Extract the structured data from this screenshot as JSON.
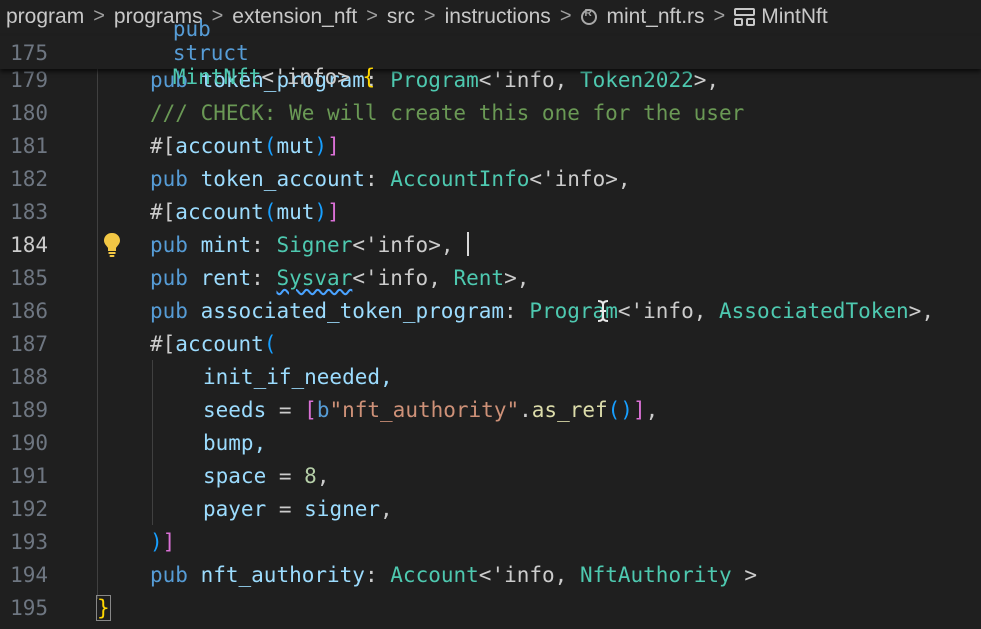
{
  "breadcrumb": {
    "items": [
      "program",
      "programs",
      "extension_nft",
      "src",
      "instructions",
      "mint_nft.rs",
      "MintNft"
    ],
    "separator": ">"
  },
  "sticky": {
    "line": "175",
    "pub": "pub",
    "struct": "struct",
    "name": "MintNft",
    "lt": "<'info>",
    "brace": "{"
  },
  "lines": [
    {
      "n": "179",
      "pub": "pub",
      "field": "token_program",
      "colon": ":",
      "type": "Program",
      "lt": "<'info, ",
      "t2": "Token2022",
      "end": ">,"
    },
    {
      "n": "180",
      "comment": "/// CHECK: We will create this one for the user"
    },
    {
      "n": "181",
      "hash": "#[",
      "attr": "account",
      "p1": "(",
      "arg": "mut",
      "p2": ")",
      "close": "]"
    },
    {
      "n": "182",
      "pub": "pub",
      "field": "token_account",
      "colon": ":",
      "type": "AccountInfo",
      "lt": "<'info>,"
    },
    {
      "n": "183",
      "hash": "#[",
      "attr": "account",
      "p1": "(",
      "arg": "mut",
      "p2": ")",
      "close": "]"
    },
    {
      "n": "184",
      "pub": "pub",
      "field": "mint",
      "colon": ":",
      "type": "Signer",
      "lt": "<'info>,"
    },
    {
      "n": "185",
      "pub": "pub",
      "field": "rent",
      "colon": ":",
      "type": "Sysvar",
      "lt": "<'info, ",
      "t2": "Rent",
      "end": ">,"
    },
    {
      "n": "186",
      "pub": "pub",
      "field": "associated_token_program",
      "colon": ":",
      "type": "Program",
      "lt": "<'info, ",
      "t2": "AssociatedToken",
      "end": ">,"
    },
    {
      "n": "187",
      "hash": "#[",
      "attr": "account",
      "p1": "("
    },
    {
      "n": "188",
      "text": "init_if_needed,"
    },
    {
      "n": "189",
      "key": "seeds",
      "eq": " = ",
      "b1": "[",
      "bpre": "b",
      "str": "\"nft_authority\"",
      "dot": ".",
      "fn": "as_ref",
      "paren": "()",
      "b2": "]",
      "comma": ","
    },
    {
      "n": "190",
      "text": "bump,"
    },
    {
      "n": "191",
      "key": "space",
      "eq": " = ",
      "num": "8",
      "comma": ","
    },
    {
      "n": "192",
      "key": "payer",
      "eq": " = ",
      "val": "signer",
      "comma": ","
    },
    {
      "n": "193",
      "p2": ")",
      "close": "]"
    },
    {
      "n": "194",
      "pub": "pub",
      "field": "nft_authority",
      "colon": ":",
      "type": "Account",
      "lt": "<'info, ",
      "t2": "NftAuthority",
      "end": " >"
    },
    {
      "n": "195",
      "brace": "}"
    }
  ],
  "colors": {
    "background": "#1f1f1f",
    "keyword": "#569cd6",
    "type": "#4ec9b0",
    "field": "#9cdcfe",
    "string": "#ce9178",
    "comment": "#6a9955",
    "bracket_gold": "#ffd700",
    "bracket_purple": "#da70d6",
    "bracket_blue": "#179fff"
  },
  "icons": [
    "rust-file-icon",
    "struct-icon",
    "lightbulb-icon",
    "text-cursor-icon"
  ]
}
